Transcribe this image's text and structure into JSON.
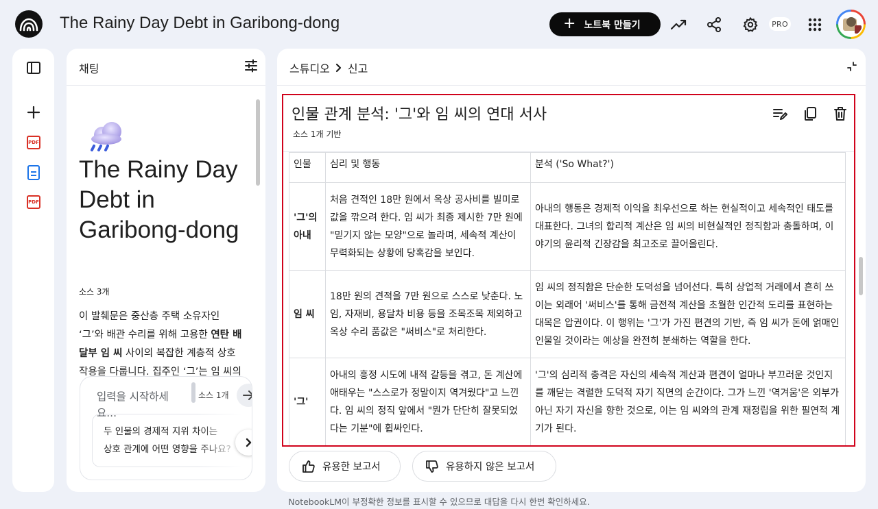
{
  "app": {
    "title": "The Rainy Day Debt in Garibong-dong",
    "new_notebook_label": "노트북 만들기",
    "pro_badge": "PRO"
  },
  "icons": {
    "logo": "notebooklm-logo-icon",
    "analytics": "trending-up-icon",
    "share": "share-icon",
    "settings": "gear-icon",
    "apps": "apps-grid-icon",
    "avatar": "user-avatar"
  },
  "rail": {
    "items": [
      {
        "name": "toggle-panel-icon"
      },
      {
        "name": "add-source-icon"
      },
      {
        "name": "pdf-source-icon",
        "label": "PDF"
      },
      {
        "name": "doc-source-icon"
      },
      {
        "name": "pdf-source-icon",
        "label": "PDF"
      }
    ]
  },
  "chat": {
    "title": "채팅",
    "notebook_title": "The Rainy Day Debt in Garibong-dong",
    "source_count": "소스 3개",
    "summary_parts": {
      "a": "이 발췌문은 중산층 주택 소유자인 ‘그’와 배관 수리를 위해 고용한 ",
      "b": "연탄 배달부 임 씨",
      "c": " 사이의 복잡한 계층적 상호작용을 다룹니다. 집주인 ‘그’는 임 씨의"
    },
    "input_placeholder": "입력을 시작하세요...",
    "input_source_count": "소스 1개",
    "suggestion_line1": "두 인물의 경제적 지위 차이는",
    "suggestion_line2": "상호 관계에 어떤 영향을 주나요?"
  },
  "studio": {
    "breadcrumb_root": "스튜디오",
    "breadcrumb_current": "신고",
    "report": {
      "title": "인물 관계 분석: '그'와 임 씨의 연대 서사",
      "subtitle": "소스 1개 기반",
      "columns": [
        "인물",
        "심리 및 행동",
        "분석 ('So What?')"
      ],
      "rows": [
        {
          "person": "'그'의 아내",
          "behavior": "처음 견적인 18만 원에서 옥상 공사비를 빌미로 값을 깎으려 한다. 임 씨가 최종 제시한 7만 원에 \"믿기지 않는 모양\"으로 놀라며, 세속적 계산이 무력화되는 상황에 당혹감을 보인다.",
          "analysis": "아내의 행동은 경제적 이익을 최우선으로 하는 현실적이고 세속적인 태도를 대표한다. 그녀의 합리적 계산은 임 씨의 비현실적인 정직함과 충돌하며, 이야기의 윤리적 긴장감을 최고조로 끌어올린다."
        },
        {
          "person": "임 씨",
          "behavior": "18만 원의 견적을 7만 원으로 스스로 낮춘다. 노임, 자재비, 용달차 비용 등을 조목조목 제외하고 옥상 수리 품값은 \"써비스\"로 처리한다.",
          "analysis": "임 씨의 정직함은 단순한 도덕성을 넘어선다. 특히 상업적 거래에서 흔히 쓰이는 외래어 '써비스'를 통해 금전적 계산을 초월한 인간적 도리를 표현하는 대목은 압권이다. 이 행위는 '그'가 가진 편견의 기반, 즉 임 씨가 돈에 얽매인 인물일 것이라는 예상을 완전히 분쇄하는 역할을 한다."
        },
        {
          "person": "'그'",
          "behavior": "아내의 흥정 시도에 내적 갈등을 겪고, 돈 계산에 애태우는 \"스스로가 정말이지 역겨웠다\"고 느낀다. 임 씨의 정직 앞에서 \"뭔가 단단히 잘못되었다는 기분\"에 휩싸인다.",
          "analysis": "'그'의 심리적 충격은 자신의 세속적 계산과 편견이 얼마나 부끄러운 것인지를 깨닫는 격렬한 도덕적 자기 직면의 순간이다. 그가 느낀 '역겨움'은 외부가 아닌 자기 자신을 향한 것으로, 이는 임 씨와의 관계 재정립을 위한 필연적 계기가 된다."
        }
      ]
    },
    "feedback_positive": "유용한 보고서",
    "feedback_negative": "유용하지 않은 보고서"
  },
  "footer": {
    "disclaimer": "NotebookLM이 부정확한 정보를 표시할 수 있으므로 대답을 다시 한번 확인하세요."
  }
}
